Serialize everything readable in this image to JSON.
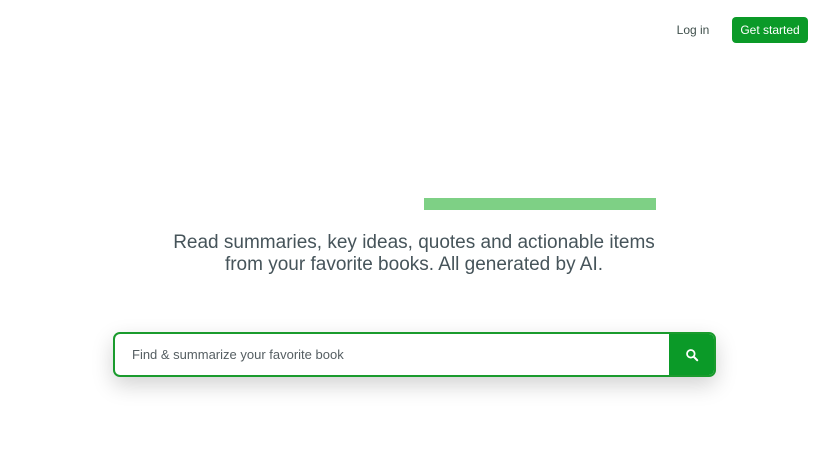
{
  "header": {
    "login_label": "Log in",
    "get_started_label": "Get started"
  },
  "hero": {
    "tagline_line1": "Read summaries, key ideas, quotes and actionable items",
    "tagline_line2": "from your favorite books. All generated by AI."
  },
  "search": {
    "placeholder": "Find & summarize your favorite book",
    "value": "",
    "button_icon": "search-icon"
  },
  "colors": {
    "accent": "#0b9a28",
    "highlight": "#7ed085",
    "text": "#46545a"
  }
}
